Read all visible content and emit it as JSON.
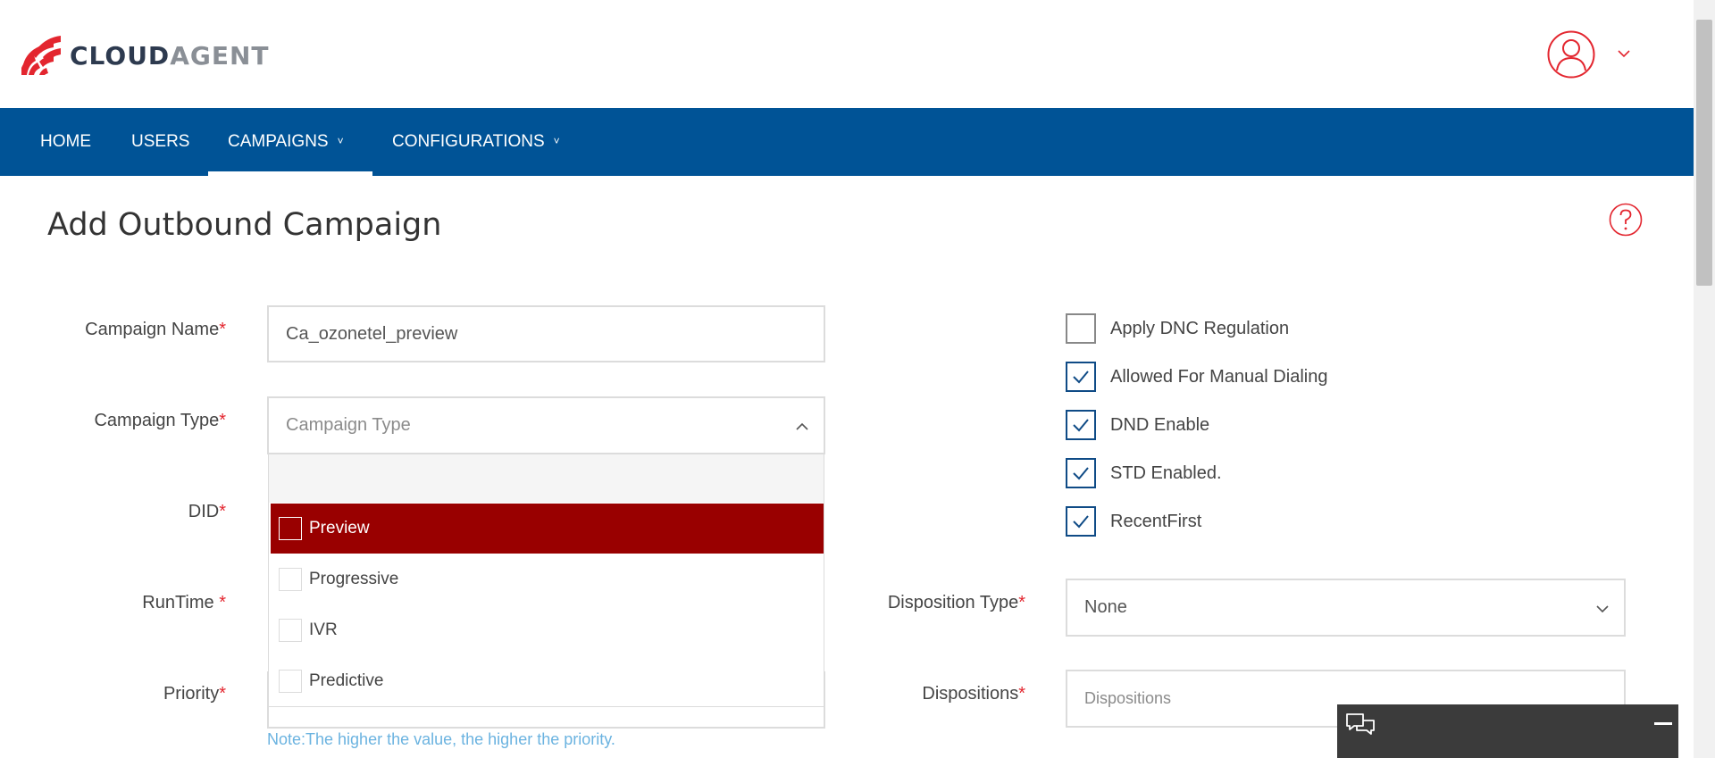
{
  "brand": {
    "name_part1": "CLOUD",
    "name_part2": "AGENT",
    "accent": "#e3262f",
    "nav_bg": "#005396"
  },
  "nav": {
    "items": [
      {
        "label": "HOME"
      },
      {
        "label": "USERS"
      },
      {
        "label": "CAMPAIGNS",
        "caret": "˅",
        "active": true
      },
      {
        "label": "CONFIGURATIONS",
        "caret": "˅"
      }
    ]
  },
  "page": {
    "title": "Add Outbound Campaign"
  },
  "form": {
    "campaign_name": {
      "label": "Campaign Name",
      "value": "Ca_ozonetel_preview"
    },
    "campaign_type": {
      "label": "Campaign Type",
      "placeholder": "Campaign Type",
      "options": [
        {
          "label": "Preview",
          "highlighted": true
        },
        {
          "label": "Progressive"
        },
        {
          "label": "IVR"
        },
        {
          "label": "Predictive"
        }
      ]
    },
    "did": {
      "label": "DID"
    },
    "runtime": {
      "label": "RunTime "
    },
    "priority": {
      "label": "Priority",
      "note": "Note:The higher the value, the higher the priority."
    },
    "required_mark": "*",
    "checkboxes": [
      {
        "label": "Apply DNC Regulation",
        "checked": false
      },
      {
        "label": "Allowed For Manual Dialing",
        "checked": true
      },
      {
        "label": "DND Enable",
        "checked": true
      },
      {
        "label": "STD Enabled.",
        "checked": true
      },
      {
        "label": "RecentFirst",
        "checked": true
      }
    ],
    "disposition_type": {
      "label": "Disposition Type",
      "value": "None"
    },
    "dispositions": {
      "label": "Dispositions",
      "placeholder": "Dispositions"
    }
  },
  "icons": {
    "avatar": "user-circle-icon",
    "help": "question-circle-icon",
    "chat": "chat-bubbles-icon",
    "minimize": "minimize-icon"
  }
}
